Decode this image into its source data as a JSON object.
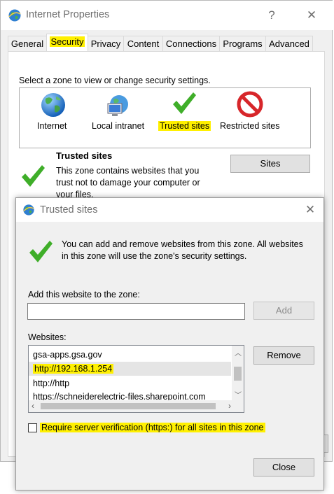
{
  "main": {
    "title": "Internet Properties",
    "help_glyph": "?",
    "close_glyph": "✕",
    "tabs": [
      {
        "label": "General"
      },
      {
        "label": "Security"
      },
      {
        "label": "Privacy"
      },
      {
        "label": "Content"
      },
      {
        "label": "Connections"
      },
      {
        "label": "Programs"
      },
      {
        "label": "Advanced"
      }
    ],
    "zone_prompt": "Select a zone to view or change security settings.",
    "zones": [
      {
        "label": "Internet",
        "icon": "globe-icon"
      },
      {
        "label": "Local intranet",
        "icon": "network-computer-icon"
      },
      {
        "label": "Trusted sites",
        "icon": "green-check-icon"
      },
      {
        "label": "Restricted sites",
        "icon": "restricted-icon"
      }
    ],
    "zone_title": "Trusted sites",
    "zone_desc_lines": [
      "This zone contains websites that you",
      "trust not to damage your computer or",
      "your files."
    ],
    "sites_button": "Sites"
  },
  "dialog": {
    "title": "Trusted sites",
    "close_glyph": "✕",
    "info_lines": [
      "You can add and remove websites from this zone. All websites",
      "in this zone will use the zone's security settings."
    ],
    "add_label": "Add this website to the zone:",
    "add_input_value": "",
    "add_button": "Add",
    "websites_label": "Websites:",
    "websites": [
      "gsa-apps.gsa.gov",
      "http://192.168.1.254",
      "http://http",
      "https://schneiderelectric-files.sharepoint.com"
    ],
    "remove_button": "Remove",
    "require_https_label": "Require server verification (https:) for all sites in this zone",
    "require_https_checked": false,
    "close_button": "Close"
  },
  "colors": {
    "highlight": "#fff000",
    "check_green": "#3fae29",
    "restricted_red": "#d7262a"
  }
}
